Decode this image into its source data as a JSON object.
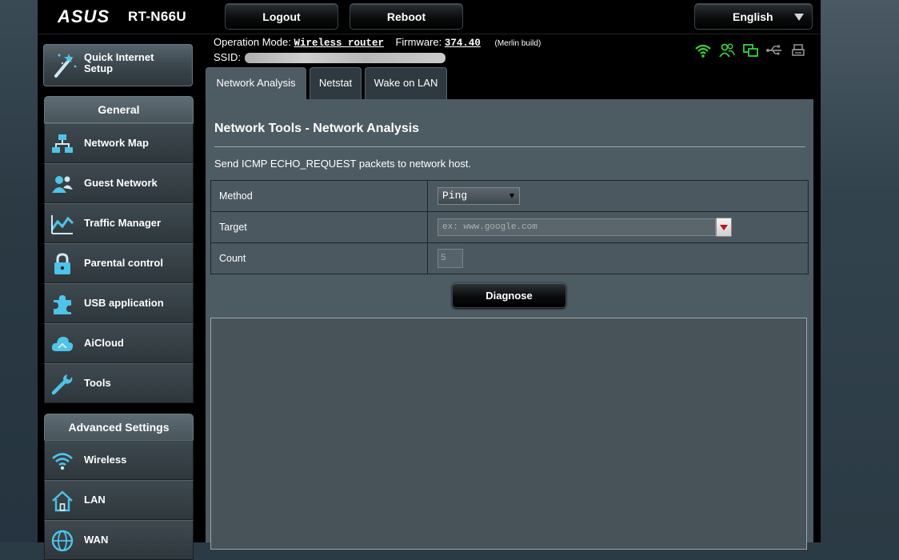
{
  "header": {
    "brand": "ASUS",
    "model": "RT-N66U",
    "logout_label": "Logout",
    "reboot_label": "Reboot",
    "language": "English",
    "operation_mode_label": "Operation Mode:",
    "operation_mode_value": "Wireless router",
    "firmware_label": "Firmware:",
    "firmware_value": "374.40",
    "firmware_note": "(Merlin build)",
    "ssid_label": "SSID:",
    "status_icons": [
      "wifi-icon",
      "guest-users-icon",
      "devices-icon",
      "usb-icon",
      "printer-icon"
    ]
  },
  "sidebar": {
    "quick_setup_label": "Quick Internet Setup",
    "general_title": "General",
    "general_items": [
      {
        "label": "Network Map",
        "icon": "network-map-icon"
      },
      {
        "label": "Guest Network",
        "icon": "guest-network-icon"
      },
      {
        "label": "Traffic Manager",
        "icon": "traffic-manager-icon"
      },
      {
        "label": "Parental control",
        "icon": "lock-icon"
      },
      {
        "label": "USB application",
        "icon": "puzzle-icon"
      },
      {
        "label": "AiCloud",
        "icon": "cloud-icon"
      },
      {
        "label": "Tools",
        "icon": "wrench-icon"
      }
    ],
    "advanced_title": "Advanced Settings",
    "advanced_items": [
      {
        "label": "Wireless",
        "icon": "wifi-icon"
      },
      {
        "label": "LAN",
        "icon": "home-icon"
      },
      {
        "label": "WAN",
        "icon": "globe-icon"
      }
    ]
  },
  "tabs": [
    {
      "label": "Network Analysis",
      "active": true
    },
    {
      "label": "Netstat",
      "active": false
    },
    {
      "label": "Wake on LAN",
      "active": false
    }
  ],
  "main": {
    "title": "Network Tools - Network Analysis",
    "description": "Send ICMP ECHO_REQUEST packets to network host.",
    "form": {
      "method_label": "Method",
      "method_value": "Ping",
      "target_label": "Target",
      "target_placeholder": "ex: www.google.com",
      "count_label": "Count",
      "count_placeholder": "5"
    },
    "diagnose_label": "Diagnose"
  },
  "colors": {
    "status_green": "#39d23a",
    "icon_blue": "#4fc3e8",
    "panel": "#4d5b62"
  }
}
